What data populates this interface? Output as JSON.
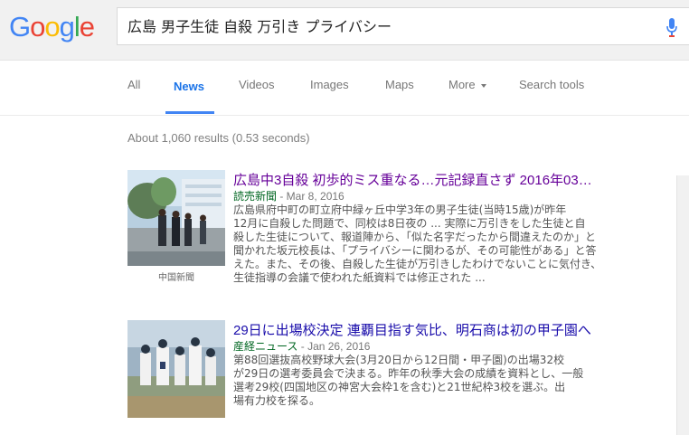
{
  "logo": {
    "c1": "G",
    "c2": "o",
    "c3": "o",
    "c4": "g",
    "c5": "l",
    "c6": "e"
  },
  "search": {
    "query": "広島 男子生徒 自殺 万引き プライバシー"
  },
  "icons": {
    "mic": "microphone-icon"
  },
  "tabs": [
    {
      "label": "All"
    },
    {
      "label": "News"
    },
    {
      "label": "Videos"
    },
    {
      "label": "Images"
    },
    {
      "label": "Maps"
    },
    {
      "label": "More"
    },
    {
      "label": "Search tools"
    }
  ],
  "active_tab": "News",
  "stats": "About 1,060 results (0.53 seconds)",
  "results": [
    {
      "title": "広島中3自殺 初歩的ミス重なる…元記録直さず 2016年03…",
      "source": "読売新聞",
      "date": " - Mar 8, 2016",
      "snippet": "広島県府中町の町立府中緑ヶ丘中学3年の男子生徒(当時15歳)が昨年\n12月に自殺した問題で、同校は8日夜の ... 実際に万引きをした生徒と自\n殺した生徒について、報道陣から、「似た名字だったから間違えたのか」と\n聞かれた坂元校長は、「プライバシーに関わるが、その可能性がある」と答\nえた。また、その後、自殺した生徒が万引きしたわけでないことに気付き、\n生徒指導の会議で使われた紙資料では修正された ...",
      "thumb_caption": "中国新聞"
    },
    {
      "title": "29日に出場校決定 連覇目指す気比、明石商は初の甲子園へ",
      "source": "産経ニュース",
      "date": " - Jan 26, 2016",
      "snippet": "第88回選抜高校野球大会(3月20日から12日間・甲子園)の出場32校\nが29日の選考委員会で決まる。昨年の秋季大会の成績を資料とし、一般\n選考29校(四国地区の神宮大会枠1を含む)と21世紀枠3校を選ぶ。出\n場有力校を探る。",
      "thumb_caption": ""
    }
  ],
  "colors": {
    "link": "#1a0dab",
    "visited": "#660099",
    "source": "#006621",
    "active_tab": "#1a73e8"
  }
}
